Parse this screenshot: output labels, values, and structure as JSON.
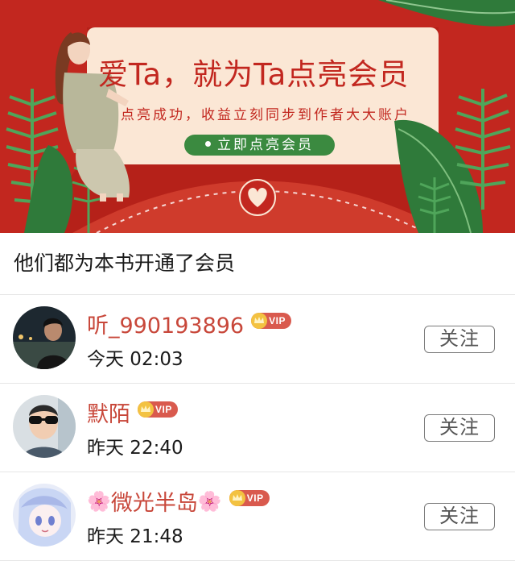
{
  "banner": {
    "title": "爱Ta，就为Ta点亮会员",
    "subtitle": "点亮成功，收益立刻同步到作者大大账户",
    "button_label": "立即点亮会员"
  },
  "section_title": "他们都为本书开通了会员",
  "vip_label": "VIP",
  "members": [
    {
      "name": "听_990193896",
      "time": "今天 02:03",
      "follow_label": "关注"
    },
    {
      "name": "默陌",
      "time": "昨天 22:40",
      "follow_label": "关注"
    },
    {
      "name": "微光半岛",
      "name_prefix": "🌸",
      "name_suffix": "🌸",
      "time": "昨天 21:48",
      "follow_label": "关注"
    }
  ],
  "colors": {
    "banner_red": "#c2271f",
    "name_red": "#c8473a",
    "button_green": "#3b8a40",
    "vip": "#d95a4e"
  }
}
